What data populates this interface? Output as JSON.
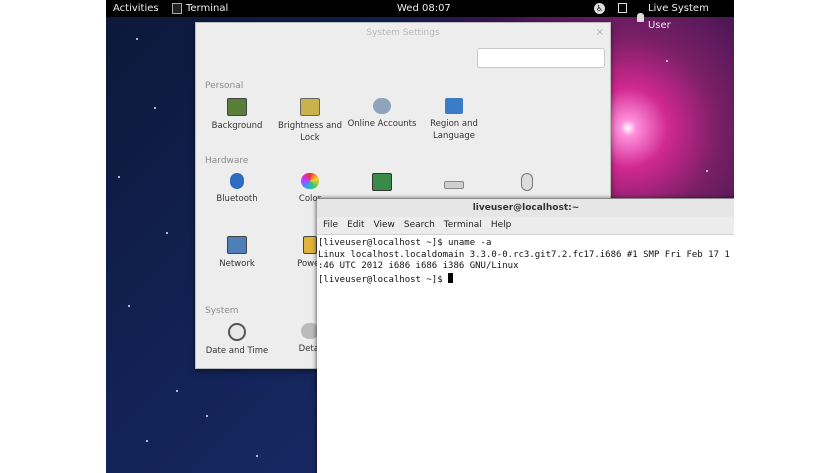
{
  "topbar": {
    "activities": "Activities",
    "app_name": "Terminal",
    "clock": "Wed 08:07",
    "user": "Live System User"
  },
  "settings": {
    "title": "System Settings",
    "close": "×",
    "sections": {
      "personal": "Personal",
      "hardware": "Hardware",
      "system": "System"
    },
    "personal_items": [
      "Background",
      "Brightness and Lock",
      "Online Accounts",
      "Region and Language"
    ],
    "hardware_items": [
      "Bluetooth",
      "Color",
      "Network",
      "Power"
    ],
    "system_items": [
      "Date and Time",
      "Detai"
    ]
  },
  "terminal": {
    "title": "liveuser@localhost:~",
    "menu": [
      "File",
      "Edit",
      "View",
      "Search",
      "Terminal",
      "Help"
    ],
    "lines": [
      "[liveuser@localhost ~]$ uname -a",
      "Linux localhost.localdomain 3.3.0-0.rc3.git7.2.fc17.i686 #1 SMP Fri Feb 17 1",
      ":46 UTC 2012 i686 i686 i386 GNU/Linux",
      "[liveuser@localhost ~]$ "
    ]
  },
  "colors": {
    "topbar": "#000000",
    "settings_bg": "#ededed",
    "terminal_bg": "#ffffff"
  }
}
